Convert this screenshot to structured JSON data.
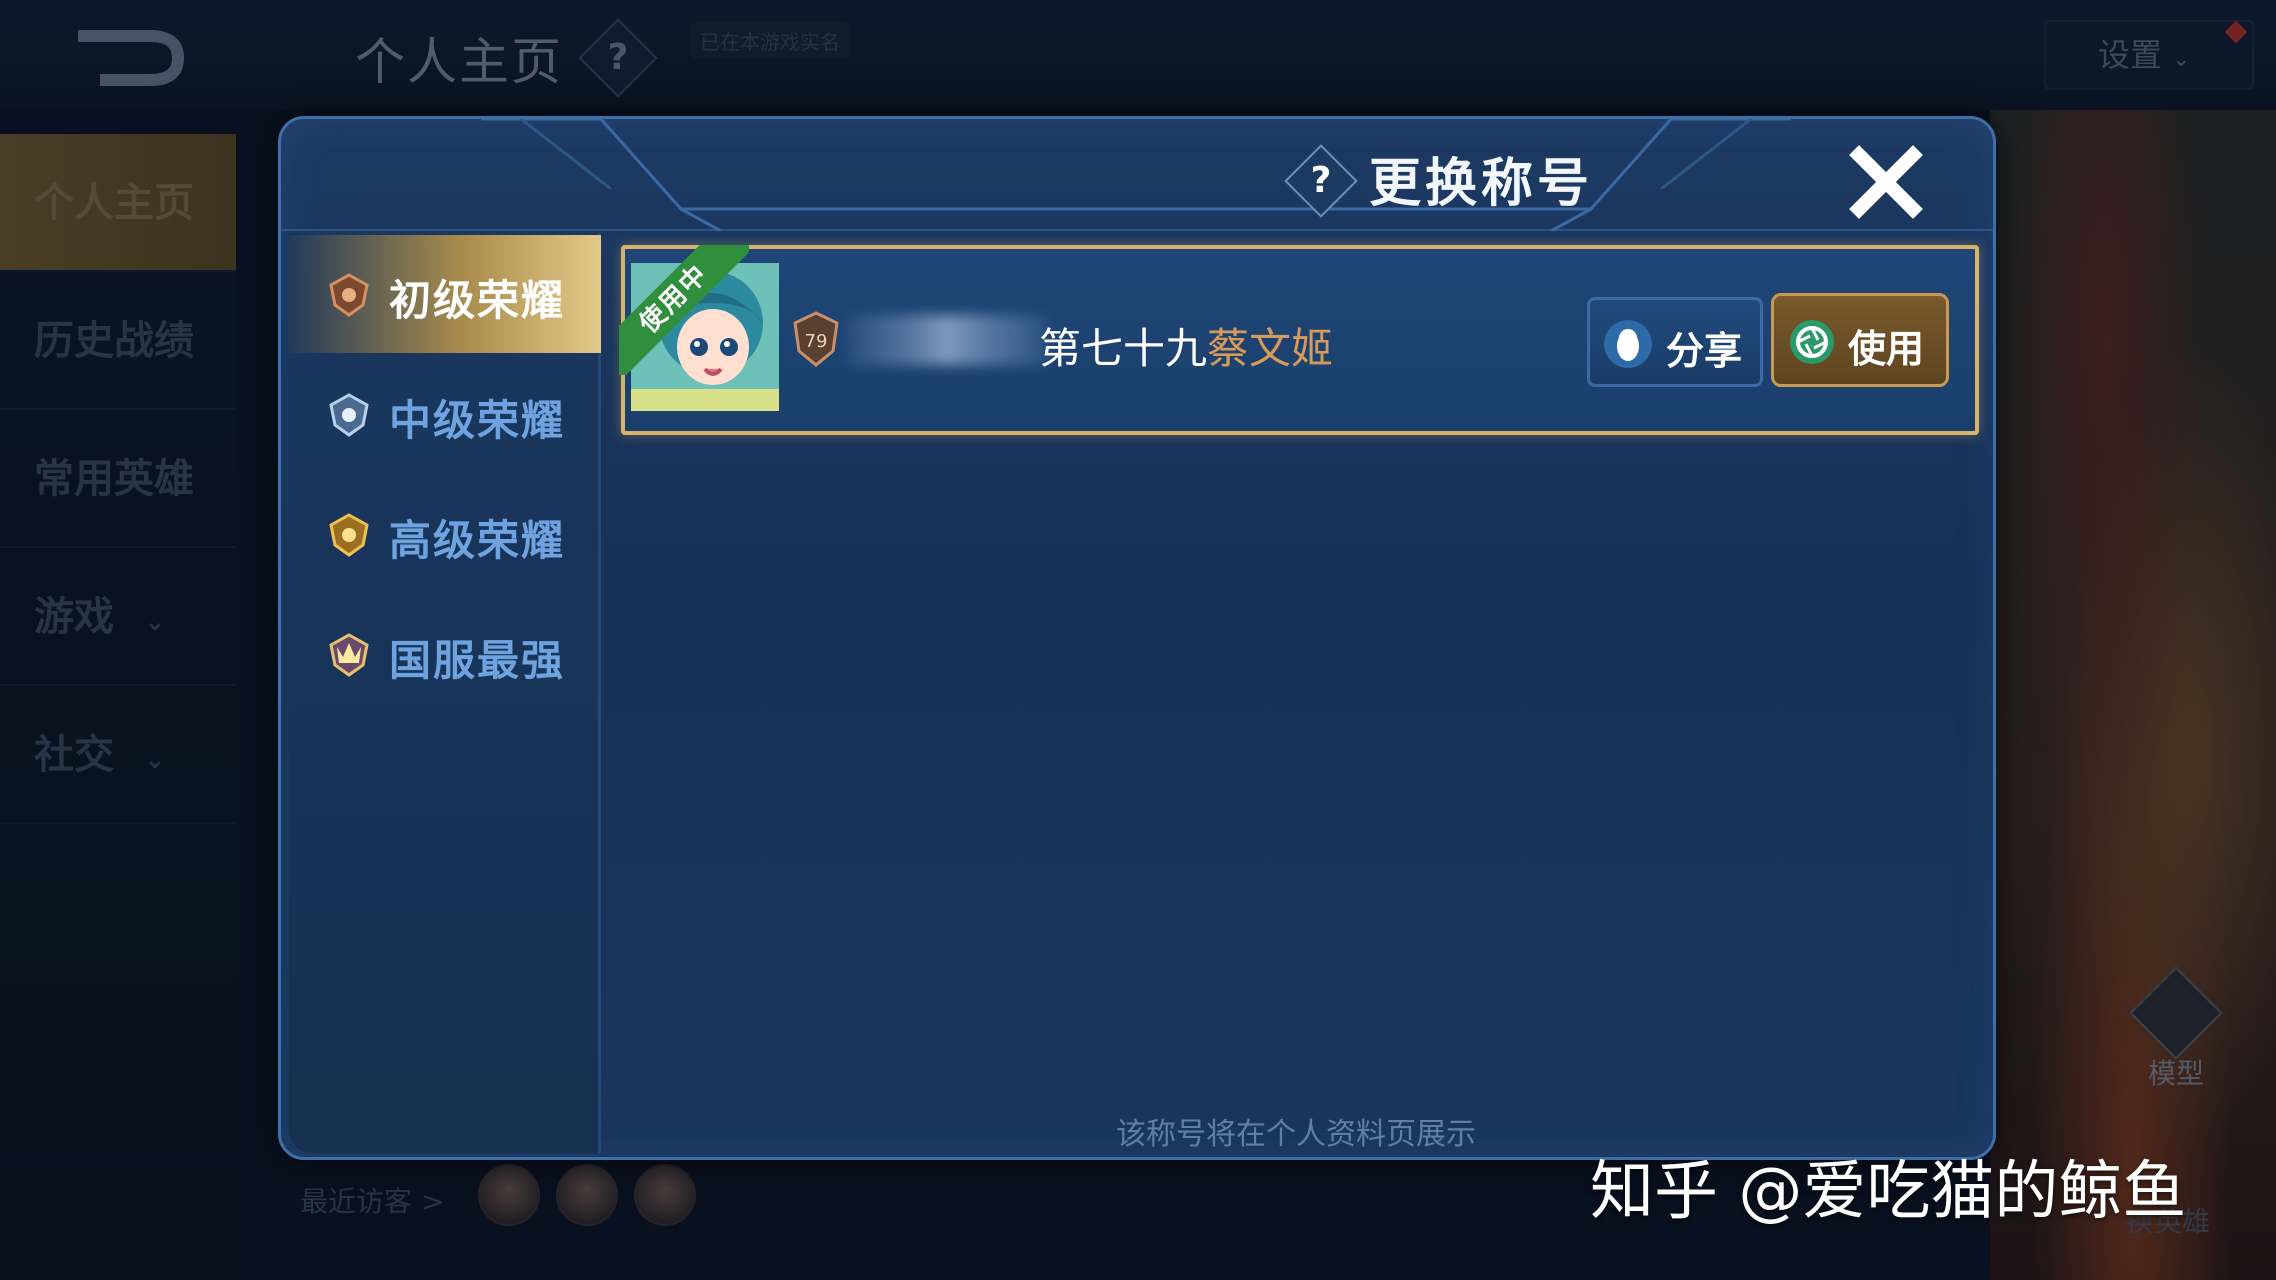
{
  "background": {
    "page_title": "个人主页",
    "help_glyph": "?",
    "verified_text": "已在本游戏实名",
    "settings_label": "设置",
    "sidebar_items": [
      {
        "label": "个人主页",
        "active": true
      },
      {
        "label": "历史战绩",
        "active": false
      },
      {
        "label": "常用英雄",
        "active": false
      },
      {
        "label": "游戏",
        "active": false,
        "has_chevron": true
      },
      {
        "label": "社交",
        "active": false,
        "has_chevron": true
      }
    ],
    "recent_visitors_label": "最近访客 >",
    "model_label": "模型",
    "swap_hero_label": "换英雄"
  },
  "modal": {
    "title": "更换称号",
    "help_glyph": "?",
    "close_icon": "close-icon",
    "tabs": [
      {
        "label": "初级荣耀",
        "active": true,
        "icon": "bronze-glory-badge-icon"
      },
      {
        "label": "中级荣耀",
        "active": false,
        "icon": "silver-glory-badge-icon"
      },
      {
        "label": "高级荣耀",
        "active": false,
        "icon": "gold-glory-badge-icon"
      },
      {
        "label": "国服最强",
        "active": false,
        "icon": "national-best-badge-icon"
      }
    ],
    "title_card": {
      "status_ribbon": "使用中",
      "rank_number": "79",
      "title_prefix": "第七十九",
      "hero_name": "蔡文姬",
      "share_label": "分享",
      "use_label": "使用"
    },
    "footer_note": "该称号将在个人资料页展示"
  },
  "watermark": "知乎 @爱吃猫的鲸鱼",
  "colors": {
    "modal_bg": "#173156",
    "modal_border": "#3e6fa8",
    "card_border_gold": "#d6b56a",
    "tab_active_gold": "#e3c987",
    "tab_inactive_text": "#6fa3e0",
    "hero_name_color": "#d69a5a",
    "inuse_green": "#2f8f3c",
    "use_button_brown": "#7a5a2c"
  }
}
